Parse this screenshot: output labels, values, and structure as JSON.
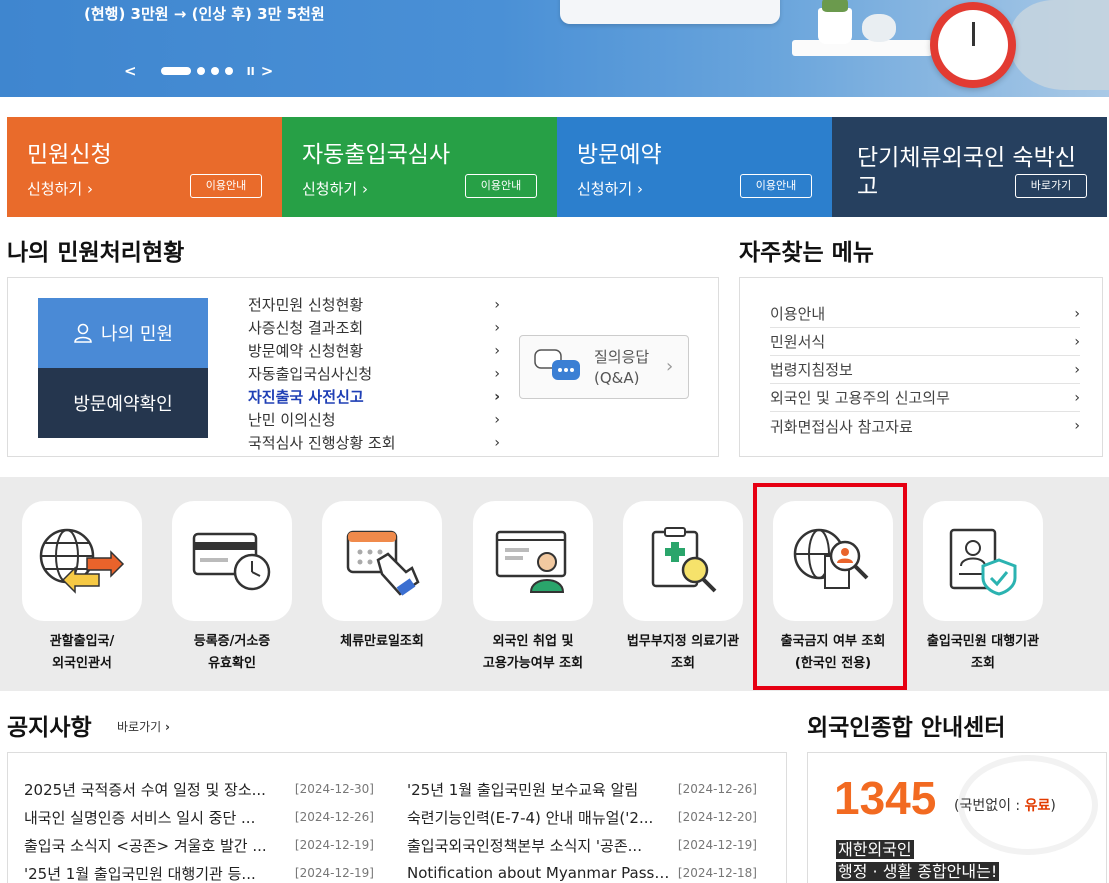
{
  "banner": {
    "text": "(현행) 3만원 → (인상 후) 3만 5천원",
    "prev": "<",
    "next": ">",
    "pause": "II"
  },
  "tiles": [
    {
      "title": "민원신청",
      "sub": "신청하기",
      "btn": "이용안내",
      "color": "#e96b2b"
    },
    {
      "title": "자동출입국심사",
      "sub": "신청하기",
      "btn": "이용안내",
      "color": "#27a046"
    },
    {
      "title": "방문예약",
      "sub": "신청하기",
      "btn": "이용안내",
      "color": "#2c7fcd"
    },
    {
      "title": "단기체류외국인 숙박신고",
      "sub": "",
      "btn": "바로가기",
      "color": "#26405f"
    }
  ],
  "my_status": {
    "title": "나의 민원처리현황",
    "my_button": "나의 민원",
    "visit_button": "방문예약확인",
    "items": [
      "전자민원 신청현황",
      "사증신청 결과조회",
      "방문예약 신청현황",
      "자동출입국심사신청",
      "자진출국 사전신고",
      "난민 이의신청",
      "국적심사 진행상황 조회"
    ],
    "qa_line1": "질의응답",
    "qa_line2": "(Q&A)"
  },
  "freq": {
    "title": "자주찾는 메뉴",
    "items": [
      "이용안내",
      "민원서식",
      "법령지침정보",
      "외국인 및 고용주의 신고의무",
      "귀화면접심사 참고자료"
    ]
  },
  "services": [
    {
      "icon": "globe-arrows-icon",
      "label": "관할출입국/\n외국인관서"
    },
    {
      "icon": "card-clock-icon",
      "label": "등록증/거소증\n유효확인"
    },
    {
      "icon": "calendar-hand-icon",
      "label": "체류만료일조회"
    },
    {
      "icon": "worker-screen-icon",
      "label": "외국인 취업 및\n고용가능여부 조회"
    },
    {
      "icon": "clipboard-search-icon",
      "label": "법무부지정 의료기관\n조회"
    },
    {
      "icon": "globe-person-search-icon",
      "label": "출국금지 여부 조회\n(한국인 전용)"
    },
    {
      "icon": "document-shield-icon",
      "label": "출입국민원 대행기관\n조회"
    }
  ],
  "notice": {
    "title": "공지사항",
    "more": "바로가기",
    "left": [
      {
        "title": "2025년 국적증서 수여 일정 및 장소...",
        "date": "[2024-12-30]"
      },
      {
        "title": "내국인 실명인증 서비스 일시 중단 ...",
        "date": "[2024-12-26]"
      },
      {
        "title": "출입국 소식지 <공존> 겨울호 발간 ...",
        "date": "[2024-12-19]"
      },
      {
        "title": "'25년 1월 출입국민원 대행기관 등...",
        "date": "[2024-12-19]"
      }
    ],
    "right": [
      {
        "title": "'25년 1월 출입국민원 보수교육 알림",
        "date": "[2024-12-26]"
      },
      {
        "title": "숙련기능인력(E-7-4) 안내 매뉴얼('2...",
        "date": "[2024-12-20]"
      },
      {
        "title": "출입국외국인정책본부 소식지 '공존...",
        "date": "[2024-12-19]"
      },
      {
        "title": "Notification about Myanmar Passp...",
        "date": "[2024-12-18]"
      }
    ]
  },
  "center": {
    "title": "외국인종합 안내센터",
    "number": "1345",
    "note_prefix": "(국번없이 : ",
    "note_fee": "유료",
    "note_suffix": ")",
    "desc1": "재한외국인",
    "desc2": "행정 · 생활 종합안내는!"
  }
}
